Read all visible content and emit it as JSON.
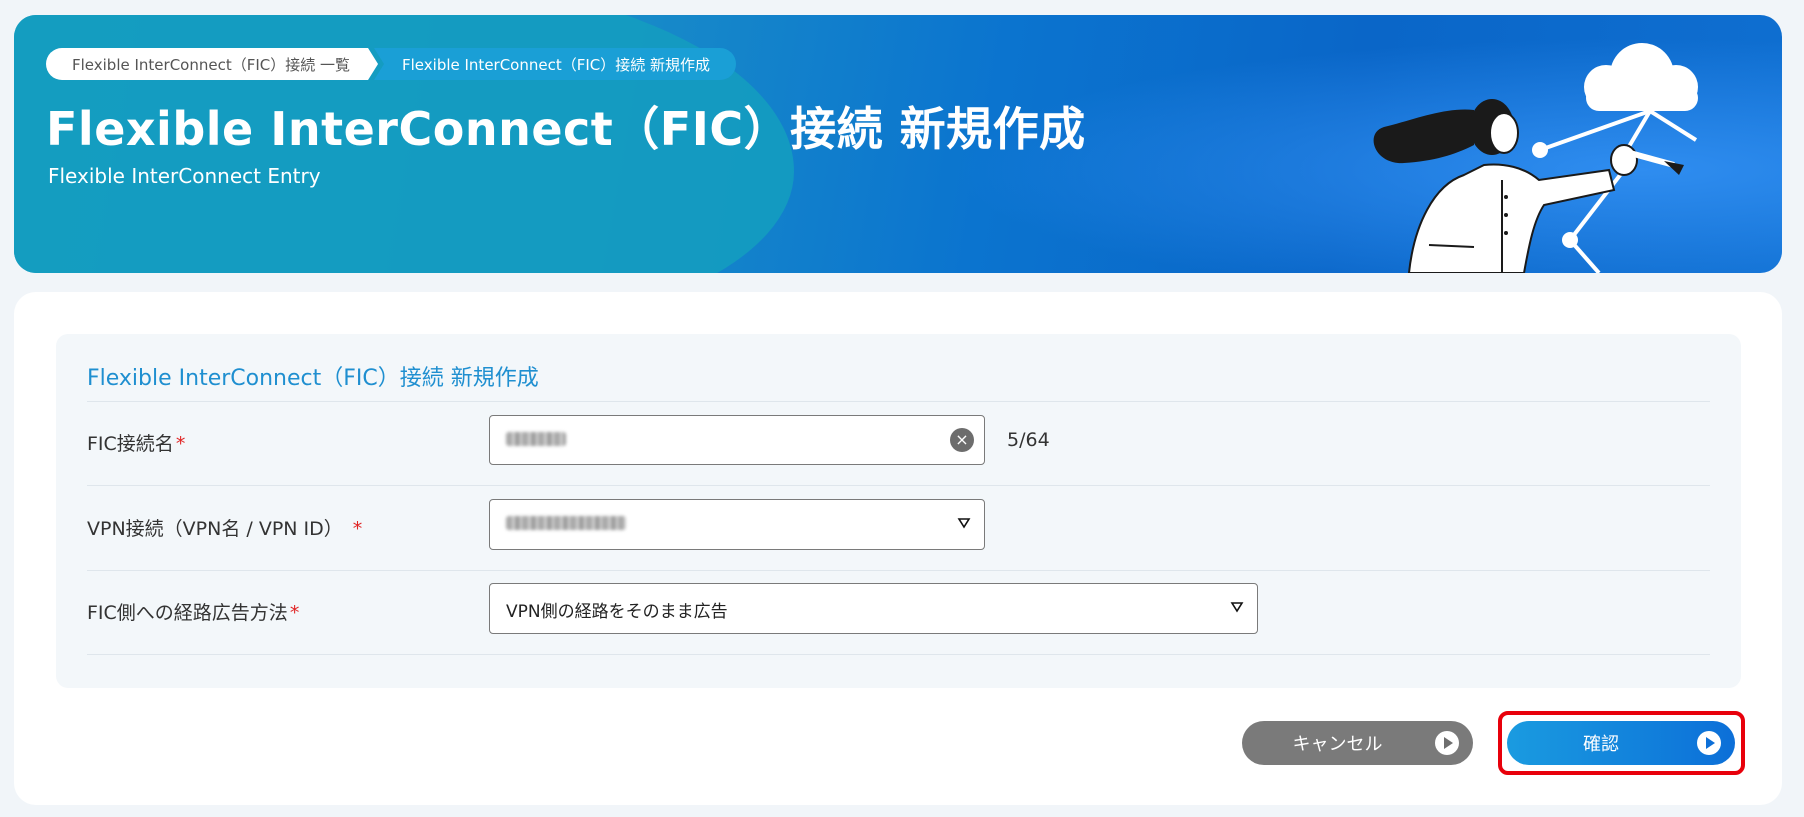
{
  "breadcrumb": {
    "items": [
      "Flexible InterConnect（FIC）接続 一覧",
      "Flexible InterConnect（FIC）接続 新規作成"
    ]
  },
  "banner": {
    "title": "Flexible InterConnect（FIC）接続 新規作成",
    "subtitle": "Flexible InterConnect Entry"
  },
  "form": {
    "panel_title": "Flexible InterConnect（FIC）接続 新規作成",
    "fic_name": {
      "label": "FIC接続名",
      "required_mark": "*",
      "counter": "5/64"
    },
    "vpn_connection": {
      "label": "VPN接続（VPN名 / VPN ID）",
      "required_mark": "*"
    },
    "route_advertise": {
      "label": "FIC側への経路広告方法",
      "required_mark": "*",
      "selected": "VPN側の経路をそのまま広告"
    }
  },
  "actions": {
    "cancel_label": "キャンセル",
    "confirm_label": "確認"
  },
  "colors": {
    "accent": "#1f8fd0",
    "required": "#e02424",
    "highlight": "#e8000b",
    "cancel_button": "#7a7a7a",
    "confirm_button": "#0c6fd8"
  }
}
